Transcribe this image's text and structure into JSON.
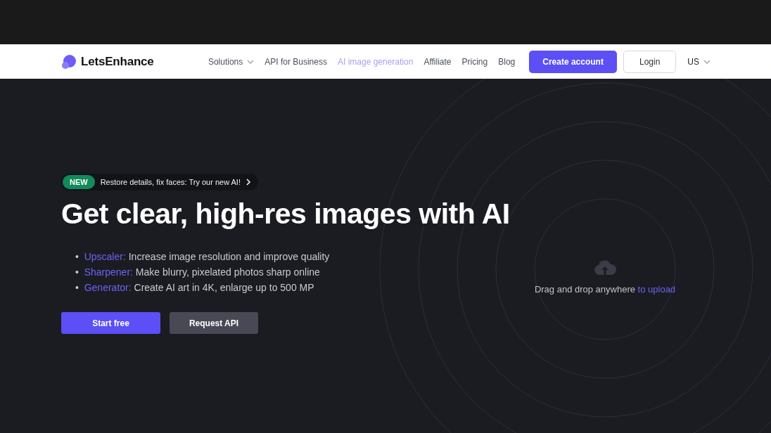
{
  "logo": {
    "text": "LetsEnhance"
  },
  "nav": [
    {
      "label": "Solutions",
      "dropdown": true,
      "selected": false
    },
    {
      "label": "API for Business",
      "dropdown": false,
      "selected": false
    },
    {
      "label": "AI image generation",
      "dropdown": false,
      "selected": true
    },
    {
      "label": "Affiliate",
      "dropdown": false,
      "selected": false
    },
    {
      "label": "Pricing",
      "dropdown": false,
      "selected": false
    },
    {
      "label": "Blog",
      "dropdown": false,
      "selected": false
    }
  ],
  "buttons": {
    "primary": "Create account",
    "secondary": "Login"
  },
  "region": "US",
  "announcement": {
    "badge": "NEW",
    "text": "Restore details, fix faces: Try our new AI!"
  },
  "headline": "Get clear, high-res images with AI",
  "features": [
    {
      "bullet": "•",
      "name": "Upscaler:",
      "text": "Increase image resolution and improve quality"
    },
    {
      "bullet": "•",
      "name": "Sharpener:",
      "text": "Make blurry, pixelated photos sharp online"
    },
    {
      "bullet": "•",
      "name": "Generator:",
      "text": "Create AI art in 4K, enlarge up to 500 MP"
    }
  ],
  "cta": {
    "primary": "Start free",
    "secondary": "Request API"
  },
  "upload": {
    "text": "Drag and drop anywhere",
    "link": "to upload"
  }
}
